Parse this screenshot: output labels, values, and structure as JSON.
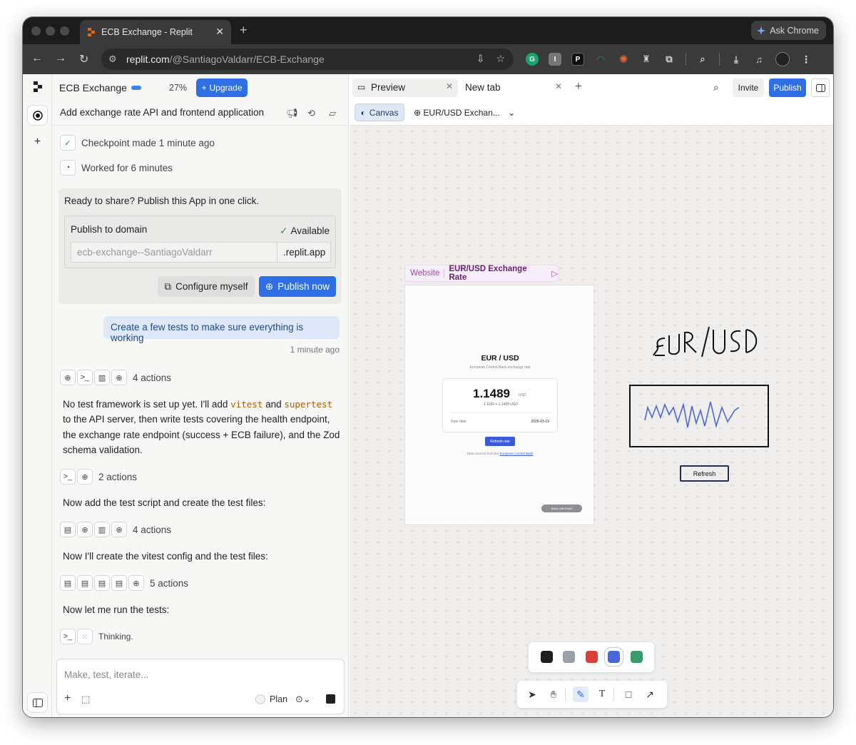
{
  "browser": {
    "tab_title": "ECB Exchange - Replit",
    "tab_close": "✕",
    "new_tab": "+",
    "ask_chrome": "Ask Chrome",
    "url_host": "replit.com",
    "url_path": "/@SantiagoValdarr/ECB-Exchange"
  },
  "app": {
    "project_name": "ECB Exchange",
    "progress_percent": "27%",
    "progress_fraction": 0.27,
    "upgrade_label": "Upgrade",
    "thread_title": "Add exchange rate API and frontend application"
  },
  "chat": {
    "checkpoint": "Checkpoint made 1 minute ago",
    "worked": "Worked for 6 minutes",
    "publish_card": {
      "ready": "Ready to share? Publish this App in one click.",
      "publish_to_domain": "Publish to domain",
      "available": "Available",
      "domain_placeholder": "ecb-exchange--SantiagoValdarr",
      "domain_suffix": ".replit.app",
      "configure": "Configure myself",
      "publish_now": "Publish now"
    },
    "user_message": "Create a few tests to make sure everything is working",
    "user_time": "1 minute ago",
    "action_groups": [
      {
        "label": "4 actions"
      },
      {
        "label": "2 actions"
      },
      {
        "label": "4 actions"
      },
      {
        "label": "5 actions"
      }
    ],
    "para1_a": "No test framework is set up yet. I'll add ",
    "para1_code1": "vitest",
    "para1_b": " and ",
    "para1_code2": "supertest",
    "para1_c": " to the API server, then write tests covering the health endpoint, the exchange rate endpoint (success + ECB failure), and the Zod schema validation.",
    "para2": "Now add the test script and create the test files:",
    "para3": "Now I'll create the vitest config and the test files:",
    "para4": "Now let me run the tests:",
    "thinking": "Thinking.",
    "composer_placeholder": "Make, test, iterate...",
    "plan_label": "Plan"
  },
  "preview": {
    "tab_preview": "Preview",
    "tab_new": "New tab",
    "invite": "Invite",
    "publish": "Publish",
    "canvas_label": "Canvas",
    "url_select": "EUR/USD Exchan...",
    "website_tag": "Website",
    "website_name": "EUR/USD Exchange Rate",
    "site": {
      "heading": "EUR / USD",
      "subheading": "European Central Bank exchange rate",
      "rate": "1.1489",
      "unit": "USD",
      "conversion": "1 EUR = 1.1489 USD",
      "rate_date_label": "Rate date",
      "rate_date_value": "2026-03-19",
      "refresh": "Refresh rate",
      "source_prefix": "Data sourced from the",
      "source_link": "European Central Bank",
      "made_with": "Made with Replit"
    },
    "sketch": {
      "handwriting": "EUR/USD",
      "button": "Refresh"
    },
    "palette_colors": [
      "#1f1f1f",
      "#9aa0a8",
      "#d9413a",
      "#4a67d6",
      "#3a9a6a"
    ],
    "selected_color": "#4a67d6"
  }
}
